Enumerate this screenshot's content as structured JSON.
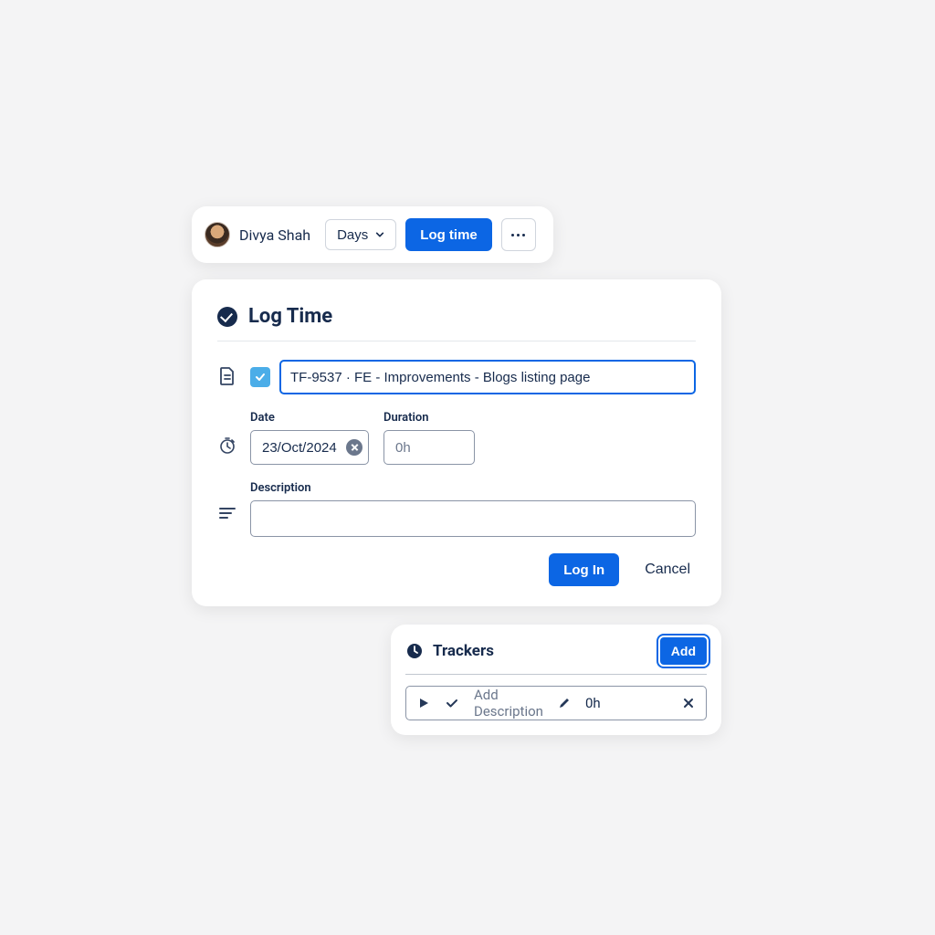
{
  "header": {
    "user_name": "Divya Shah",
    "view_dropdown": "Days",
    "log_time_button": "Log time"
  },
  "log_time_panel": {
    "title": "Log Time",
    "issue_value": "TF-9537 · FE - Improvements - Blogs listing page",
    "date_label": "Date",
    "date_value": "23/Oct/2024",
    "duration_label": "Duration",
    "duration_placeholder": "0h",
    "duration_value": "",
    "description_label": "Description",
    "description_value": "",
    "submit_button": "Log In",
    "cancel_button": "Cancel"
  },
  "trackers_panel": {
    "title": "Trackers",
    "add_button": "Add",
    "row": {
      "description_placeholder": "Add Description",
      "duration": "0h"
    }
  }
}
